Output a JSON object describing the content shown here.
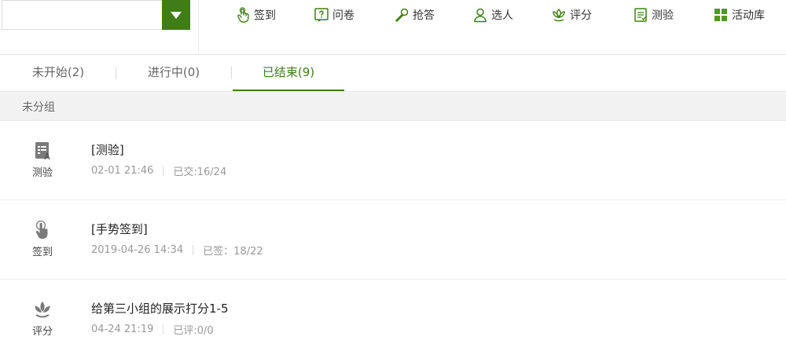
{
  "select": {
    "value": ""
  },
  "toolbar": [
    {
      "label": "签到",
      "icon": "hand-touch-icon"
    },
    {
      "label": "问卷",
      "icon": "questionnaire-icon"
    },
    {
      "label": "抢答",
      "icon": "microphone-icon"
    },
    {
      "label": "选人",
      "icon": "person-icon"
    },
    {
      "label": "评分",
      "icon": "flower-icon"
    },
    {
      "label": "测验",
      "icon": "quiz-icon"
    },
    {
      "label": "活动库",
      "icon": "grid-icon"
    }
  ],
  "tabs": [
    {
      "label": "未开始(2)",
      "active": false
    },
    {
      "label": "进行中(0)",
      "active": false
    },
    {
      "label": "已结束(9)",
      "active": true
    }
  ],
  "group": {
    "label": "未分组"
  },
  "items": [
    {
      "type_label": "测验",
      "type_icon": "quiz-icon",
      "title": "[测验]",
      "time": "02-01 21:46",
      "status": "已交:16/24"
    },
    {
      "type_label": "签到",
      "type_icon": "hand-touch-icon",
      "title": "[手势签到]",
      "time": "2019-04-26 14:34",
      "status": "已签：18/22"
    },
    {
      "type_label": "评分",
      "type_icon": "flower-icon",
      "title": "给第三小组的展示打分1-5",
      "time": "04-24 21:19",
      "status": "已评:0/0"
    }
  ],
  "colors": {
    "accent": "#3f7d18",
    "icon_gray": "#777777"
  }
}
